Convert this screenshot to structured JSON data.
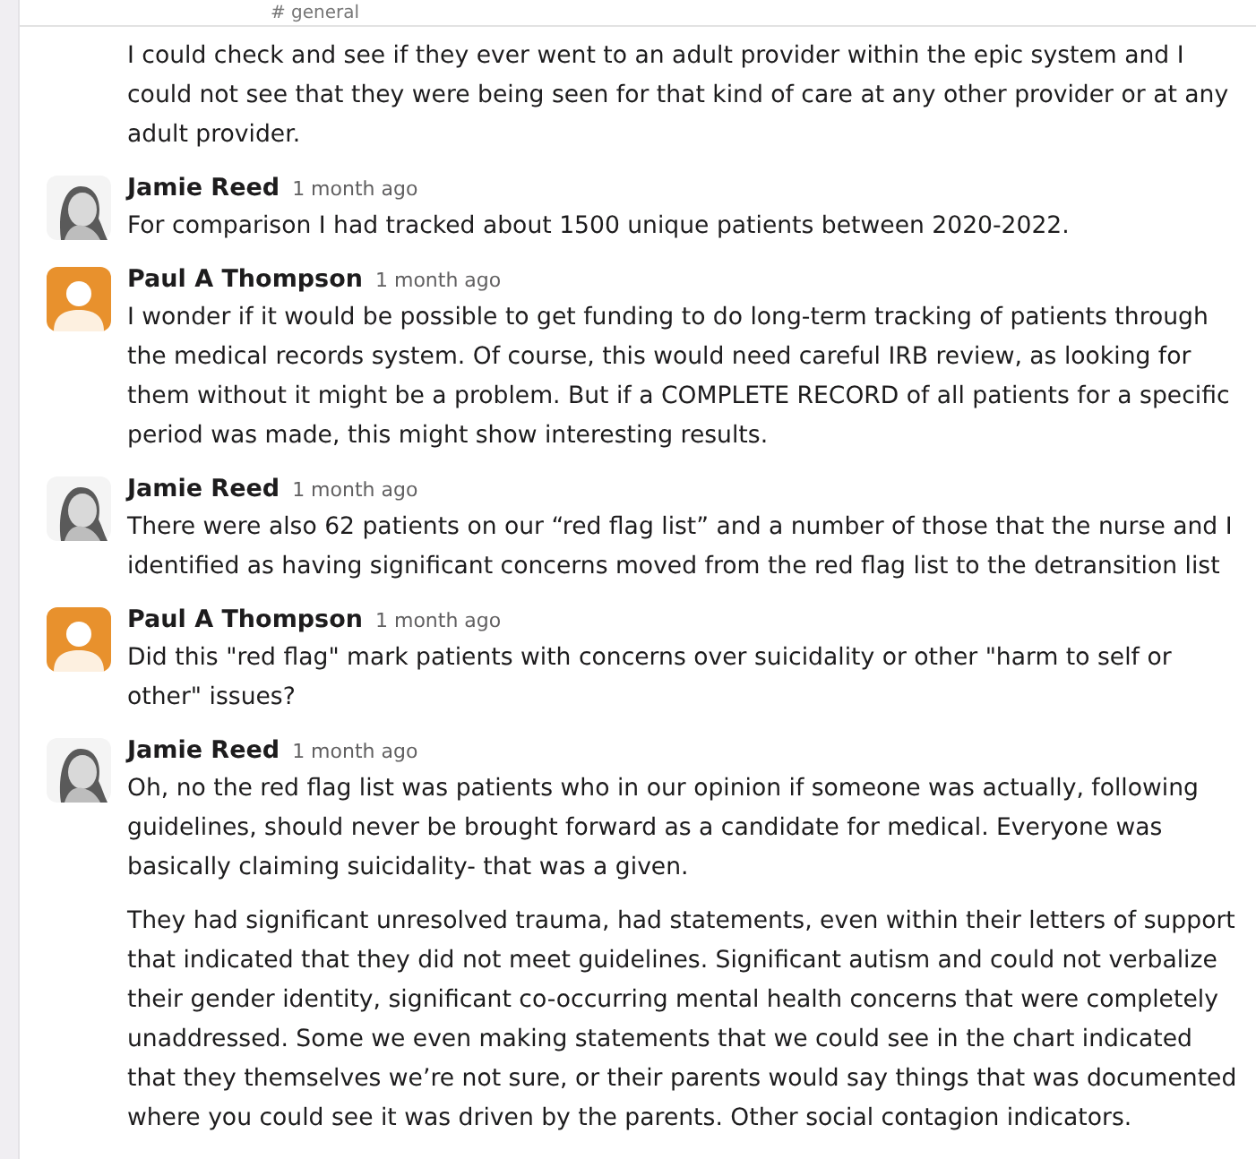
{
  "channel": {
    "title": "# general"
  },
  "messages": [
    {
      "paragraphs": [
        "I could check and see if they ever went to an adult provider within the epic system and I could not see that they were being seen for that kind of care at any other provider or at any adult provider."
      ]
    },
    {
      "author": "Jamie Reed",
      "time": "1 month ago",
      "avatar": {
        "kind": "photo"
      },
      "paragraphs": [
        "For comparison I had tracked about 1500 unique patients between 2020-2022."
      ]
    },
    {
      "author": "Paul A Thompson",
      "time": "1 month ago",
      "avatar": {
        "kind": "default"
      },
      "paragraphs": [
        "I wonder if it would be possible to get funding to do long-term tracking of patients through the medical records system. Of course, this would need careful IRB review, as looking for them without it might be a problem. But if a COMPLETE RECORD of all patients for a specific period was made, this might show interesting results."
      ]
    },
    {
      "author": "Jamie Reed",
      "time": "1 month ago",
      "avatar": {
        "kind": "photo"
      },
      "paragraphs": [
        "There were also 62 patients on our “red flag list” and a number of those that the nurse and I identified as having significant concerns moved from the red flag list to the detransition list"
      ]
    },
    {
      "author": "Paul A Thompson",
      "time": "1 month ago",
      "avatar": {
        "kind": "default"
      },
      "paragraphs": [
        "Did this \"red flag\" mark patients with concerns over suicidality or other \"harm to self or other\" issues?"
      ]
    },
    {
      "author": "Jamie Reed",
      "time": "1 month ago",
      "avatar": {
        "kind": "photo"
      },
      "paragraphs": [
        "Oh, no the red flag list was patients who in our opinion if someone was actually, following guidelines, should never be brought forward as a candidate for medical. Everyone was basically claiming suicidality- that was a given.",
        "They had significant unresolved trauma, had statements, even within their letters of support that indicated that they did not meet guidelines. Significant autism and could not verbalize their gender identity, significant co-occurring mental health concerns that were completely unaddressed. Some we even making statements that we could see in the chart indicated that they themselves we’re not sure, or their parents would say things that was documented where you could see it was driven by the parents. Other social contagion indicators."
      ]
    }
  ]
}
